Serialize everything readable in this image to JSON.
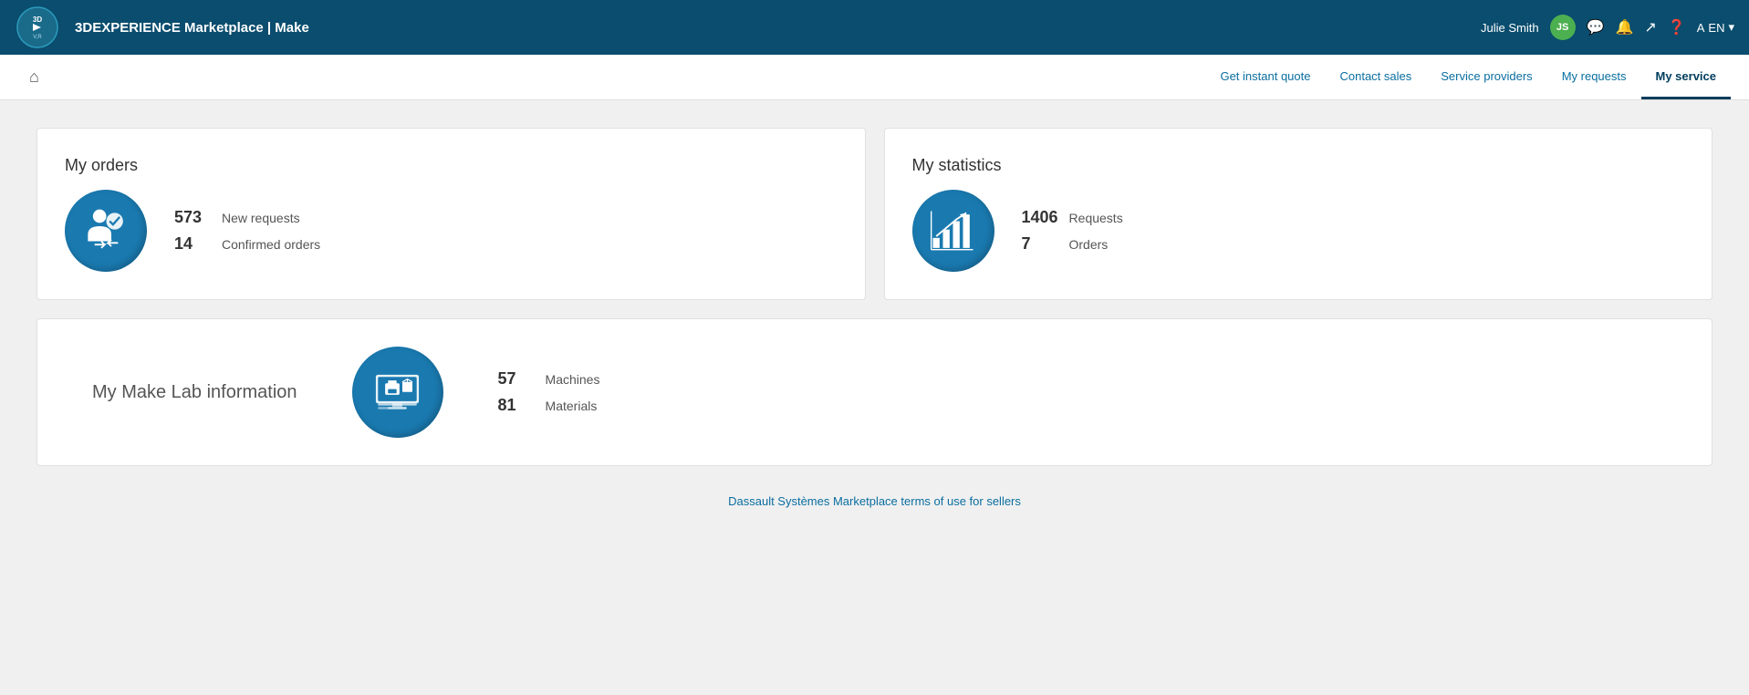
{
  "app": {
    "title_bold": "3D",
    "title_regular": "EXPERIENCE Marketplace | Make"
  },
  "header": {
    "user_name": "Julie Smith",
    "user_initials": "JS",
    "lang": "EN",
    "lang_icon": "▾"
  },
  "nav": {
    "home_icon": "⌂",
    "items": [
      {
        "label": "Get instant quote",
        "active": false
      },
      {
        "label": "Contact sales",
        "active": false
      },
      {
        "label": "Service providers",
        "active": false
      },
      {
        "label": "My requests",
        "active": false
      },
      {
        "label": "My service",
        "active": true
      }
    ]
  },
  "orders_card": {
    "title": "My orders",
    "stats": [
      {
        "number": "573",
        "label": "New requests"
      },
      {
        "number": "14",
        "label": "Confirmed orders"
      }
    ]
  },
  "statistics_card": {
    "title": "My statistics",
    "stats": [
      {
        "number": "1406",
        "label": "Requests"
      },
      {
        "number": "7",
        "label": "Orders"
      }
    ]
  },
  "makelab_card": {
    "title": "My Make Lab information",
    "stats": [
      {
        "number": "57",
        "label": "Machines"
      },
      {
        "number": "81",
        "label": "Materials"
      }
    ]
  },
  "footer": {
    "link_text": "Dassault Systèmes Marketplace terms of use for sellers"
  }
}
